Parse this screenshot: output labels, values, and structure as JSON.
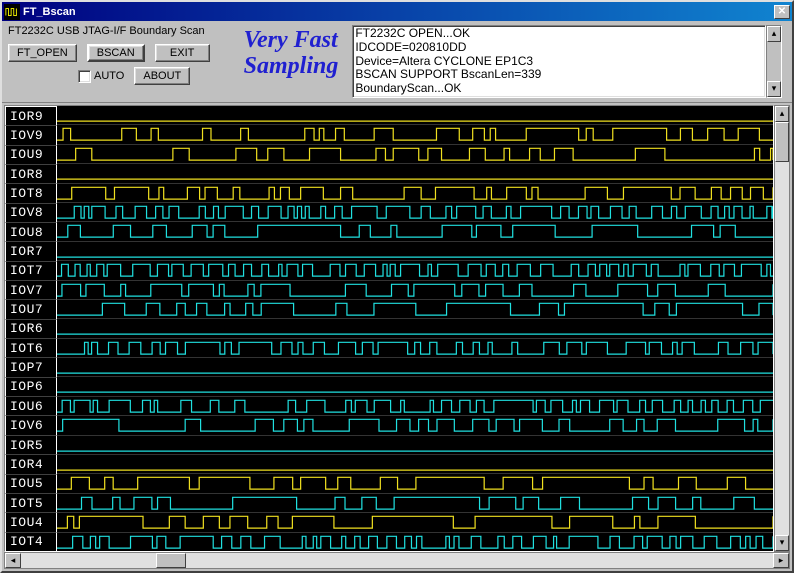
{
  "window": {
    "title": "FT_Bscan"
  },
  "toolbar": {
    "label": "FT2232C USB JTAG-I/F Boundary Scan",
    "ft_open": "FT_OPEN",
    "bscan": "BSCAN",
    "exit": "EXIT",
    "auto": "AUTO",
    "about": "ABOUT"
  },
  "overlay": {
    "line1": "Very Fast",
    "line2": "Sampling"
  },
  "log": [
    "FT2232C OPEN...OK",
    "IDCODE=020810DD",
    "Device=Altera CYCLONE EP1C3",
    "BSCAN SUPPORT BscanLen=339",
    "BoundaryScan...OK"
  ],
  "signals": [
    {
      "name": "IOR9",
      "color": "yellow",
      "pattern": 2
    },
    {
      "name": "IOV9",
      "color": "yellow",
      "pattern": 1
    },
    {
      "name": "IOU9",
      "color": "yellow",
      "pattern": 1
    },
    {
      "name": "IOR8",
      "color": "yellow",
      "pattern": 2
    },
    {
      "name": "IOT8",
      "color": "yellow",
      "pattern": 1
    },
    {
      "name": "IOV8",
      "color": "cyan",
      "pattern": 3
    },
    {
      "name": "IOU8",
      "color": "cyan",
      "pattern": 1
    },
    {
      "name": "IOR7",
      "color": "cyan",
      "pattern": 2
    },
    {
      "name": "IOT7",
      "color": "cyan",
      "pattern": 3
    },
    {
      "name": "IOV7",
      "color": "cyan",
      "pattern": 1
    },
    {
      "name": "IOU7",
      "color": "cyan",
      "pattern": 1
    },
    {
      "name": "IOR6",
      "color": "cyan",
      "pattern": 2
    },
    {
      "name": "IOT6",
      "color": "cyan",
      "pattern": 3
    },
    {
      "name": "IOP7",
      "color": "cyan",
      "pattern": 2
    },
    {
      "name": "IOP6",
      "color": "cyan",
      "pattern": 2
    },
    {
      "name": "IOU6",
      "color": "cyan",
      "pattern": 3
    },
    {
      "name": "IOV6",
      "color": "cyan",
      "pattern": 1
    },
    {
      "name": "IOR5",
      "color": "cyan",
      "pattern": 2
    },
    {
      "name": "IOR4",
      "color": "yellow",
      "pattern": 2
    },
    {
      "name": "IOU5",
      "color": "yellow",
      "pattern": 1
    },
    {
      "name": "IOT5",
      "color": "cyan",
      "pattern": 1
    },
    {
      "name": "IOU4",
      "color": "yellow",
      "pattern": 1
    },
    {
      "name": "IOT4",
      "color": "cyan",
      "pattern": 3
    }
  ]
}
